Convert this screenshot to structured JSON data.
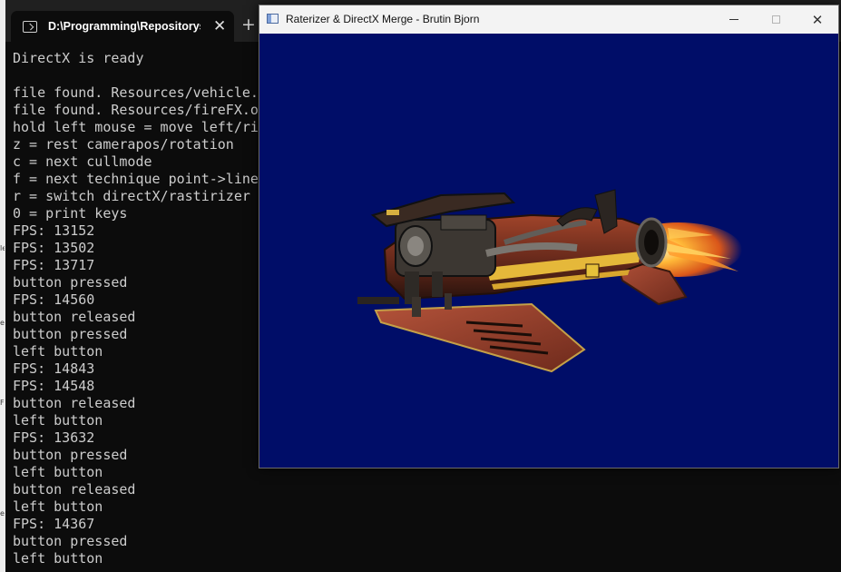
{
  "terminal": {
    "tab_title": "D:\\Programming\\Repositorys\\",
    "tab_icon": "terminal-icon",
    "close_glyph": "✕",
    "new_tab_glyph": "+",
    "lines": [
      "DirectX is ready",
      "",
      "file found. Resources/vehicle.",
      "file found. Resources/fireFX.o",
      "hold left mouse = move left/ri",
      "z = rest camerapos/rotation",
      "c = next cullmode",
      "f = next technique point->line",
      "r = switch directX/rastirizer",
      "0 = print keys",
      "FPS: 13152",
      "FPS: 13502",
      "FPS: 13717",
      "button pressed",
      "FPS: 14560",
      "button released",
      "button pressed",
      "left button",
      "FPS: 14843",
      "FPS: 14548",
      "button released",
      "left button",
      "FPS: 13632",
      "button pressed",
      "left button",
      "button released",
      "left button",
      "FPS: 14367",
      "button pressed",
      "left button"
    ]
  },
  "render_window": {
    "title": "Raterizer & DirectX Merge - Brutin Bjorn",
    "close_glyph": "✕",
    "viewport_color": "#000d68"
  },
  "colors": {
    "terminal_bg": "#0c0c0c",
    "terminal_text": "#cccccc",
    "tabbar_bg": "#202020"
  }
}
